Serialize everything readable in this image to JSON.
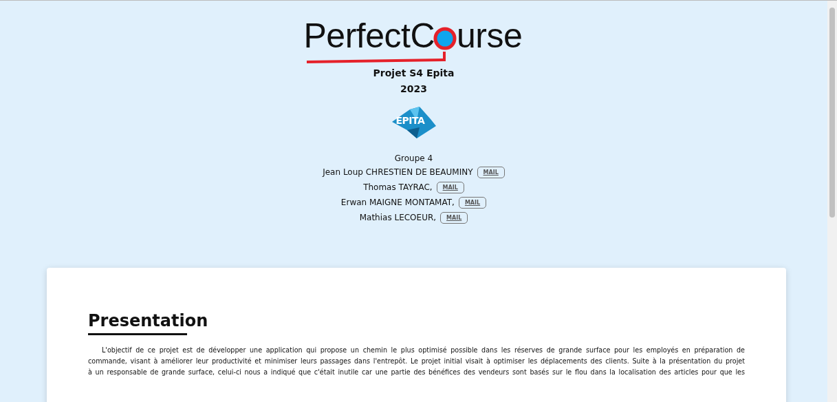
{
  "logo": {
    "text_before": "PerfectC",
    "text_after": "urse"
  },
  "project": {
    "title": "Projet S4 Epita",
    "year": "2023",
    "school_logo": "EPITA"
  },
  "group": {
    "label": "Groupe 4",
    "members": [
      {
        "name": "Jean Loup CHRESTIEN DE BEAUMINY",
        "button": "MAIL"
      },
      {
        "name": "Thomas TAYRAC,",
        "button": "MAIL"
      },
      {
        "name": "Erwan MAIGNE MONTAMAT,",
        "button": "MAIL"
      },
      {
        "name": "Mathias LECOEUR,",
        "button": "MAIL"
      }
    ]
  },
  "card": {
    "heading": "Presentation",
    "paragraph_lines": [
      "L'objectif de ce projet est de développer une application qui propose un chemin le plus optimisé possible dans les réserves de grande surface pour les employés en préparation de",
      "commande, visant à améliorer leur productivité et minimiser leurs passages dans l'entrepôt. Le projet initial visait à optimiser les déplacements des clients. Suite à la présentation du projet",
      "à un responsable de grande surface, celui-ci nous a indiqué que c'était inutile car une partie des bénéfices des vendeurs sont basés sur le flou dans la localisation des articles pour que les"
    ]
  }
}
